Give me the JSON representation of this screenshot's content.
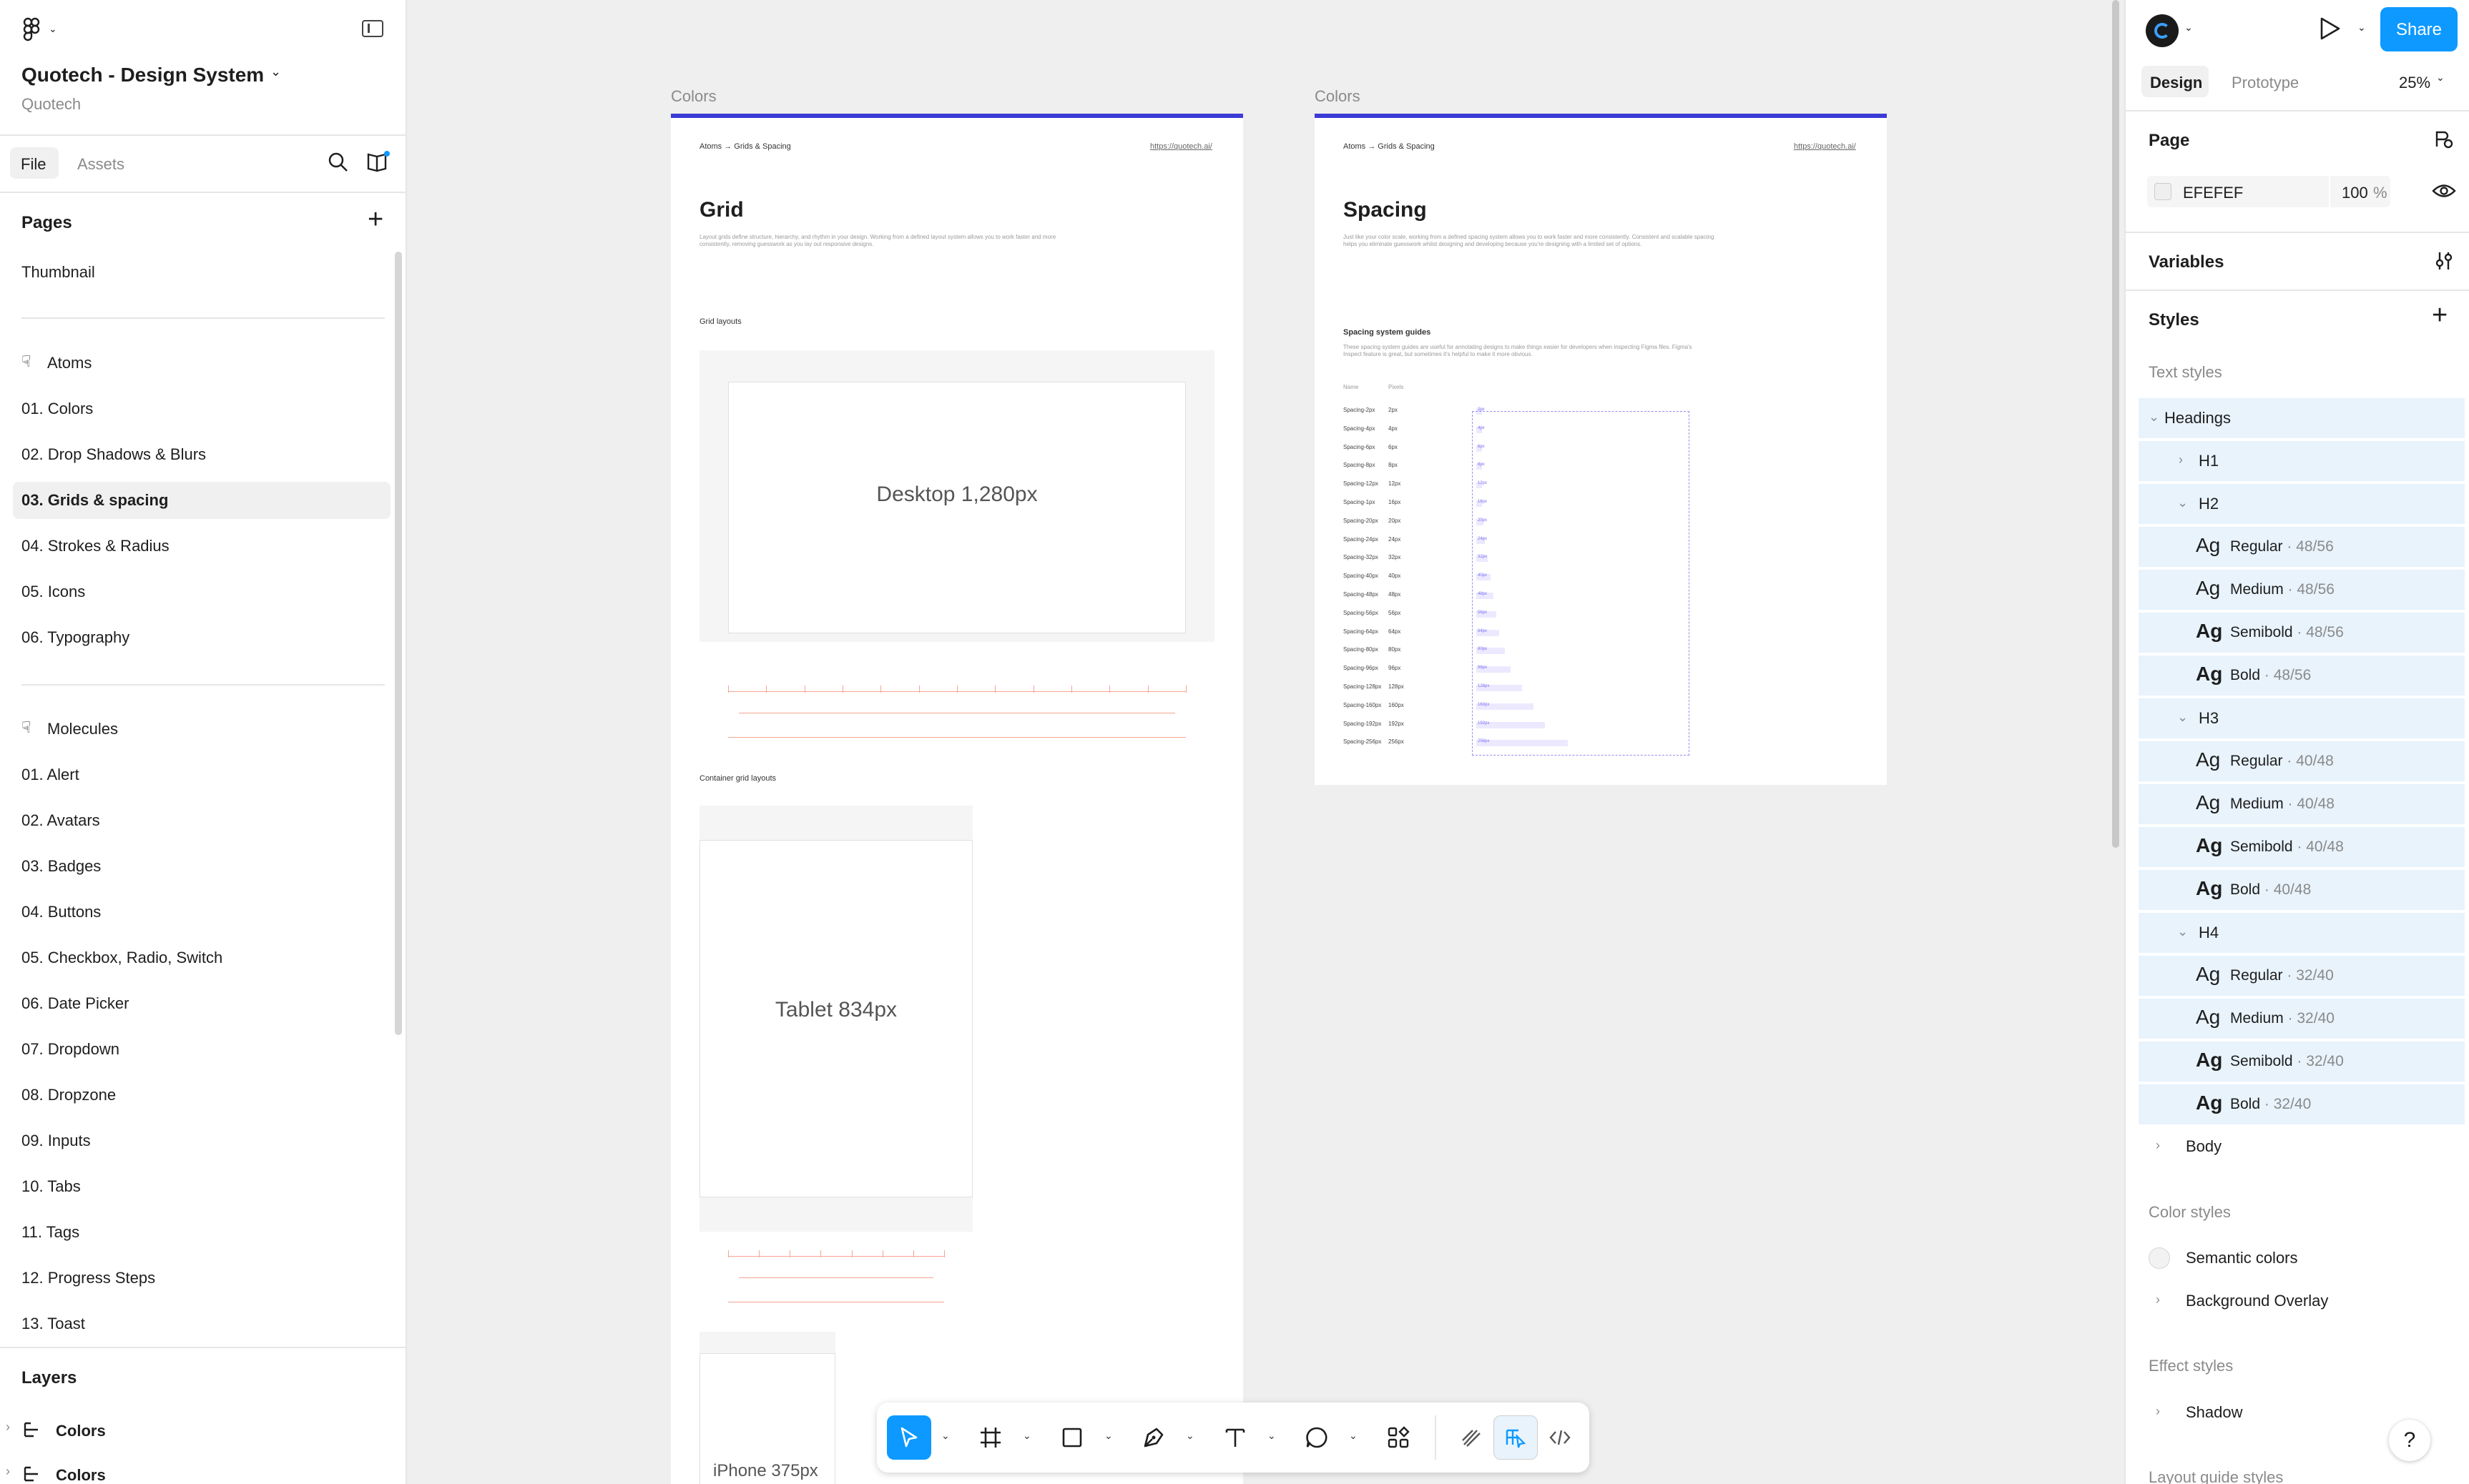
{
  "file": {
    "title": "Quotech - Design System",
    "team": "Quotech"
  },
  "left_tabs": {
    "file": "File",
    "assets": "Assets"
  },
  "pages": {
    "heading": "Pages",
    "thumbnail": "Thumbnail",
    "atoms_header": "Atoms",
    "atoms": [
      "01. Colors",
      "02. Drop Shadows & Blurs",
      "03. Grids & spacing",
      "04. Strokes & Radius",
      "05. Icons",
      "06. Typography"
    ],
    "molecules_header": "Molecules",
    "molecules": [
      "01.  Alert",
      "02. Avatars",
      "03. Badges",
      "04. Buttons",
      "05. Checkbox, Radio, Switch",
      "06. Date Picker",
      "07. Dropdown",
      "08. Dropzone",
      "09. Inputs",
      "10. Tabs",
      "11. Tags",
      "12. Progress Steps",
      "13. Toast"
    ]
  },
  "layers": {
    "heading": "Layers",
    "items": [
      "Colors",
      "Colors"
    ]
  },
  "canvas": {
    "frame1": {
      "label": "Colors",
      "breadcrumb": "Atoms → Grids & Spacing",
      "link": "https://quotech.ai/",
      "title": "Grid",
      "desc": "Layout grids define structure, hierarchy, and rhythm in your design. Working from a defined layout system allows you to work faster and more consistently, removing guesswork as you lay out responsive designs.",
      "section1": "Grid layouts",
      "desktop": "Desktop 1,280px",
      "section2": "Container grid layouts",
      "tablet": "Tablet 834px",
      "iphone": "iPhone 375px"
    },
    "frame2": {
      "label": "Colors",
      "breadcrumb": "Atoms → Grids & Spacing",
      "link": "https://quotech.ai/",
      "title": "Spacing",
      "desc": "Just like your color scale, working from a defined spacing system allows you to work faster and more consistently. Consistent and scalable spacing helps you eliminate guesswork whilst designing and developing because you're designing with a limited set of options.",
      "section": "Spacing system guides",
      "section_desc": "These spacing system guides are useful for annotating designs to make things easier for developers when inspecting Figma files. Figma's Inspect feature is great, but sometimes it's helpful to make it more obvious.",
      "col_name": "Name",
      "col_pixels": "Pixels",
      "rows": [
        [
          "Spacing-2px",
          "2px"
        ],
        [
          "Spacing-4px",
          "4px"
        ],
        [
          "Spacing-6px",
          "6px"
        ],
        [
          "Spacing-8px",
          "8px"
        ],
        [
          "Spacing-12px",
          "12px"
        ],
        [
          "Spacing-1px",
          "16px"
        ],
        [
          "Spacing-20px",
          "20px"
        ],
        [
          "Spacing-24px",
          "24px"
        ],
        [
          "Spacing-32px",
          "32px"
        ],
        [
          "Spacing-40px",
          "40px"
        ],
        [
          "Spacing-48px",
          "48px"
        ],
        [
          "Spacing-56px",
          "56px"
        ],
        [
          "Spacing-64px",
          "64px"
        ],
        [
          "Spacing-80px",
          "80px"
        ],
        [
          "Spacing-96px",
          "96px"
        ],
        [
          "Spacing-128px",
          "128px"
        ],
        [
          "Spacing-160px",
          "160px"
        ],
        [
          "Spacing-192px",
          "192px"
        ],
        [
          "Spacing-256px",
          "256px"
        ]
      ]
    }
  },
  "right": {
    "tabs": {
      "design": "Design",
      "prototype": "Prototype"
    },
    "zoom": "25%",
    "share": "Share",
    "page_heading": "Page",
    "page_color": "EFEFEF",
    "page_opacity": "100",
    "page_opacity_unit": "%",
    "variables": "Variables",
    "styles": "Styles",
    "text_styles": "Text styles",
    "headings": "Headings",
    "h1": "H1",
    "h2": "H2",
    "h3": "H3",
    "h4": "H4",
    "h2_items": [
      [
        "Regular",
        "48/56"
      ],
      [
        "Medium",
        "48/56"
      ],
      [
        "Semibold",
        "48/56"
      ],
      [
        "Bold",
        "48/56"
      ]
    ],
    "h3_items": [
      [
        "Regular",
        "40/48"
      ],
      [
        "Medium",
        "40/48"
      ],
      [
        "Semibold",
        "40/48"
      ],
      [
        "Bold",
        "40/48"
      ]
    ],
    "h4_items": [
      [
        "Regular",
        "32/40"
      ],
      [
        "Medium",
        "32/40"
      ],
      [
        "Semibold",
        "32/40"
      ],
      [
        "Bold",
        "32/40"
      ]
    ],
    "ag": "Ag",
    "body": "Body",
    "color_styles": "Color styles",
    "semantic": "Semantic colors",
    "bg_overlay": "Background Overlay",
    "effect_styles": "Effect styles",
    "shadow": "Shadow",
    "layout_guides": "Layout guide styles",
    "help": "?"
  },
  "colors": {
    "accent": "#0d99ff",
    "frame_bar": "#3b3bd6",
    "selected_row": "#e8f3fc"
  }
}
